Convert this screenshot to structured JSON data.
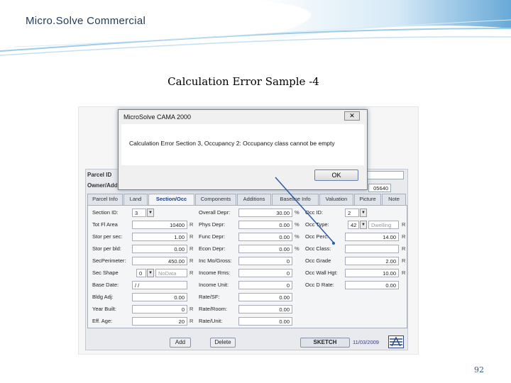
{
  "brand": "Micro.Solve Commercial",
  "slide_title": "Calculation Error  Sample -4",
  "page_number": "92",
  "colors": {
    "accent": "#5a9fd4",
    "annotation_line": "#2a5ba8"
  },
  "dialog": {
    "title": "MicroSolve CAMA 2000",
    "close_glyph": "✕",
    "message": "Calculation Error Section 3, Occupancy 2: Occupancy class cannot be empty",
    "ok_label": "OK"
  },
  "app": {
    "parcel_id_label": "Parcel ID",
    "owner_label": "Owner/Add",
    "owner_value": "05640",
    "tabs": [
      "Parcel Info",
      "Land",
      "Section/Occ",
      "Components",
      "Additions",
      "Baseline Info",
      "Valuation",
      "Picture",
      "Note"
    ],
    "active_tab": "Section/Occ",
    "col1": {
      "section_id_label": "Section ID:",
      "section_id_value": "3",
      "tot_fl_area_label": "Tot Fl Area",
      "tot_fl_area_value": "10400",
      "stor_per_sec_label": "Stor per sec:",
      "stor_per_sec_value": "1.00",
      "stor_per_bld_label": "Stor per bld:",
      "stor_per_bld_value": "0.00",
      "sec_perimeter_label": "SecPerimeter:",
      "sec_perimeter_value": "450.00",
      "sec_shape_label": "Sec Shape",
      "sec_shape_value": "0",
      "sec_shape_text": "NoData",
      "base_date_label": "Base Date:",
      "base_date_value": "/ /",
      "bldg_adj_label": "Bldg Adj:",
      "bldg_adj_value": "0.00",
      "year_built_label": "Year Built:",
      "year_built_value": "0",
      "eff_age_label": "Eff. Age:",
      "eff_age_value": "20",
      "r_suffix": "R"
    },
    "col2": {
      "overall_depr_label": "Overall Depr:",
      "overall_depr_value": "30.00",
      "phys_depr_label": "Phys Depr:",
      "phys_depr_value": "0.00",
      "func_depr_label": "Func Depr:",
      "func_depr_value": "0.00",
      "econ_depr_label": "Econ Depr:",
      "econ_depr_value": "0.00",
      "inc_mo_gross_label": "Inc Mo/Gross:",
      "inc_mo_gross_value": "0",
      "income_rms_label": "Income Rms:",
      "income_rms_value": "0",
      "income_unit_label": "Income Unit:",
      "income_unit_value": "0",
      "rate_sf_label": "Rate/SF:",
      "rate_sf_value": "0.00",
      "rate_room_label": "Rate/Room:",
      "rate_room_value": "0.00",
      "rate_unit_label": "Rate/Unit:",
      "rate_unit_value": "0.00",
      "pct_suffix": "%"
    },
    "col3": {
      "occ_id_label": "Occ ID:",
      "occ_id_value": "2",
      "occ_type_label": "Occ Type:",
      "occ_type_value": "42",
      "occ_type_text": "Dwelling",
      "occ_perc_label": "Occ Perc:",
      "occ_perc_value": "14.00",
      "occ_class_label": "Occ Class:",
      "occ_class_value": "",
      "occ_grade_label": "Occ Grade",
      "occ_grade_value": "2.00",
      "occ_wall_hgt_label": "Occ Wall Hgt:",
      "occ_wall_hgt_value": "10.00",
      "occ_d_rate_label": "Occ D Rate:",
      "occ_d_rate_value": "0.00",
      "r_suffix": "R"
    },
    "buttons": {
      "add": "Add",
      "delete": "Delete",
      "sketch": "SKETCH"
    },
    "date": "11/03/2009",
    "dropdown_glyph": "▼"
  }
}
